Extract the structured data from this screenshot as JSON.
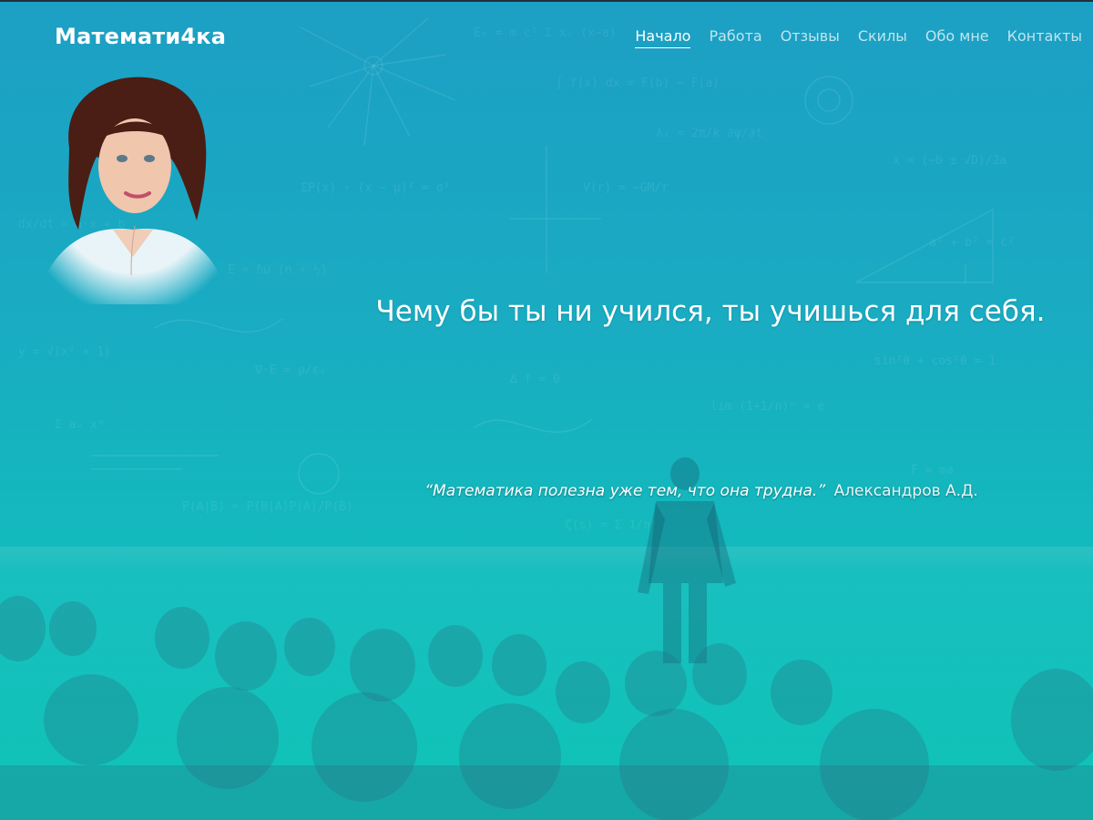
{
  "site": {
    "brand": "Математи4ка"
  },
  "nav": {
    "items": [
      {
        "label": "Начало",
        "active": true
      },
      {
        "label": "Работа"
      },
      {
        "label": "Отзывы"
      },
      {
        "label": "Скилы"
      },
      {
        "label": "Обо мне"
      },
      {
        "label": "Контакты"
      }
    ]
  },
  "hero": {
    "tagline": "Чему бы ты ни учился, ты учишься для себя.",
    "quote": "“Математика полезна уже тем, что она трудна.”",
    "quote_author": "Александров А.Д."
  },
  "theme": {
    "gradient_top": "#1c9fc4",
    "gradient_bottom": "#0fc4b6",
    "text": "#ffffff"
  }
}
